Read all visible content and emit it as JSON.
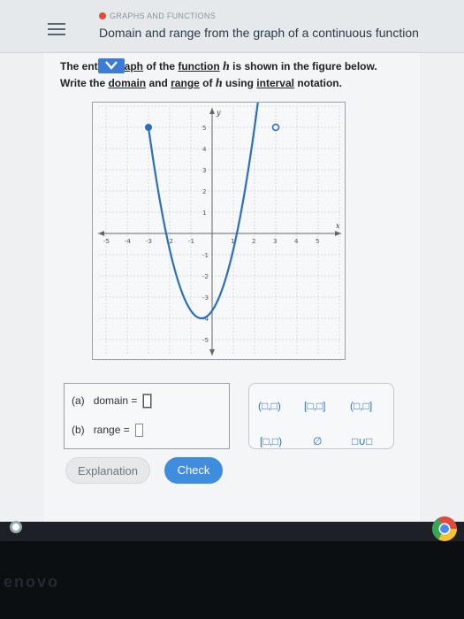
{
  "header": {
    "category": "GRAPHS AND FUNCTIONS",
    "title": "Domain and range from the graph of a continuous function"
  },
  "prompt": {
    "line1_a": "The ent",
    "line1_b": "aph",
    "line1_c": " of the ",
    "line1_d": "function",
    "line1_e": " is shown in the figure below.",
    "func_var": "h",
    "line2_a": "Write the ",
    "line2_b": "domain",
    "line2_c": " and ",
    "line2_d": "range",
    "line2_e": " of ",
    "line2_f": " using ",
    "line2_g": "interval",
    "line2_h": " notation."
  },
  "graph": {
    "x_axis_label": "x",
    "y_axis_label": "y",
    "x_ticks": [
      "-5",
      "-4",
      "-3",
      "-2",
      "-1",
      "1",
      "2",
      "3",
      "4",
      "5"
    ],
    "y_ticks": [
      "5",
      "4",
      "3",
      "2",
      "1",
      "-1",
      "-2",
      "-3",
      "-4",
      "-5"
    ]
  },
  "chart_data": {
    "type": "line",
    "x_range": [
      -6,
      6
    ],
    "y_range": [
      -6,
      6
    ],
    "grid": true,
    "curve": "parabola",
    "vertex": [
      -0.5,
      -4
    ],
    "left_endpoint": {
      "x": -3,
      "y": 5,
      "closed": true
    },
    "right_endpoint": {
      "x": 3,
      "y": 5,
      "closed": false
    }
  },
  "answer": {
    "a_label": "(a)",
    "domain_label": "domain",
    "b_label": "(b)",
    "range_label": "range",
    "equals": "="
  },
  "palette": {
    "open_open": "(□,□)",
    "closed_closed": "[□,□]",
    "open_closed": "(□,□]",
    "closed_open": "[□,□)",
    "empty_set": "∅",
    "union": "□∪□"
  },
  "buttons": {
    "explanation": "Explanation",
    "check": "Check"
  },
  "bezel": {
    "brand": "enovo"
  }
}
